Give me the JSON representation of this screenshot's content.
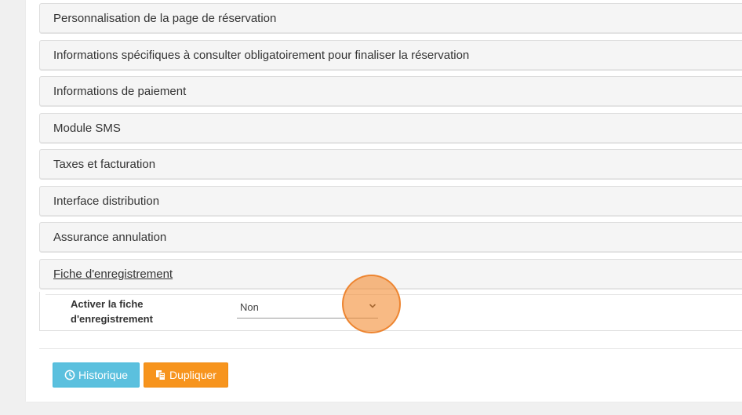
{
  "sections": [
    {
      "title": "Personnalisation de la page de réservation"
    },
    {
      "title": "Informations spécifiques à consulter obligatoirement pour finaliser la réservation"
    },
    {
      "title": "Informations de paiement"
    },
    {
      "title": "Module SMS"
    },
    {
      "title": "Taxes et facturation"
    },
    {
      "title": "Interface distribution"
    },
    {
      "title": "Assurance annulation"
    },
    {
      "title": "Fiche d'enregistrement"
    }
  ],
  "fiche": {
    "field_label": "Activer la fiche d'enregistrement",
    "select_value": "Non"
  },
  "buttons": {
    "history_label": "Historique",
    "duplicate_label": "Dupliquer"
  },
  "colors": {
    "history": "#5bc0de",
    "duplicate": "#f7941d"
  },
  "icons": {
    "history": "clock-icon",
    "duplicate": "copy-icon",
    "select": "chevron-down-icon"
  }
}
